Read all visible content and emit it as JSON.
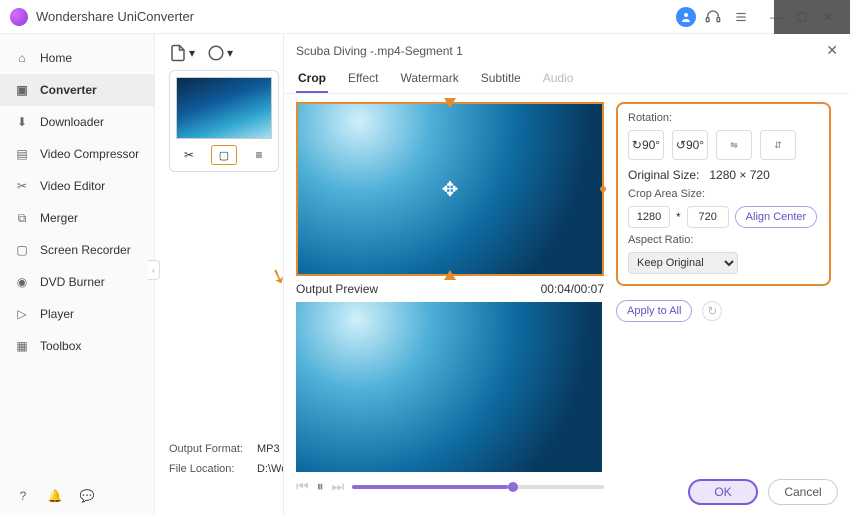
{
  "app": {
    "title": "Wondershare UniConverter"
  },
  "sidebar": {
    "items": [
      {
        "label": "Home"
      },
      {
        "label": "Converter"
      },
      {
        "label": "Downloader"
      },
      {
        "label": "Video Compressor"
      },
      {
        "label": "Video Editor"
      },
      {
        "label": "Merger"
      },
      {
        "label": "Screen Recorder"
      },
      {
        "label": "DVD Burner"
      },
      {
        "label": "Player"
      },
      {
        "label": "Toolbox"
      }
    ]
  },
  "footer": {
    "out_fmt_label": "Output Format:",
    "out_fmt_value": "MP3",
    "loc_label": "File Location:",
    "loc_value": "D:\\Wonders"
  },
  "editor": {
    "title": "Scuba Diving -.mp4-Segment 1",
    "tabs": {
      "crop": "Crop",
      "effect": "Effect",
      "watermark": "Watermark",
      "subtitle": "Subtitle",
      "audio": "Audio"
    },
    "output_preview": "Output Preview",
    "time": "00:04/00:07",
    "rotation_label": "Rotation:",
    "rot": {
      "cw": "90°",
      "ccw": "90°"
    },
    "orig_size_label": "Original Size:",
    "orig_size_value": "1280 × 720",
    "crop_size_label": "Crop Area Size:",
    "crop_w": "1280",
    "crop_mul": "*",
    "crop_h": "720",
    "align_center": "Align Center",
    "aspect_label": "Aspect Ratio:",
    "aspect_value": "Keep Original",
    "apply_all": "Apply to All",
    "ok": "OK",
    "cancel": "Cancel"
  }
}
